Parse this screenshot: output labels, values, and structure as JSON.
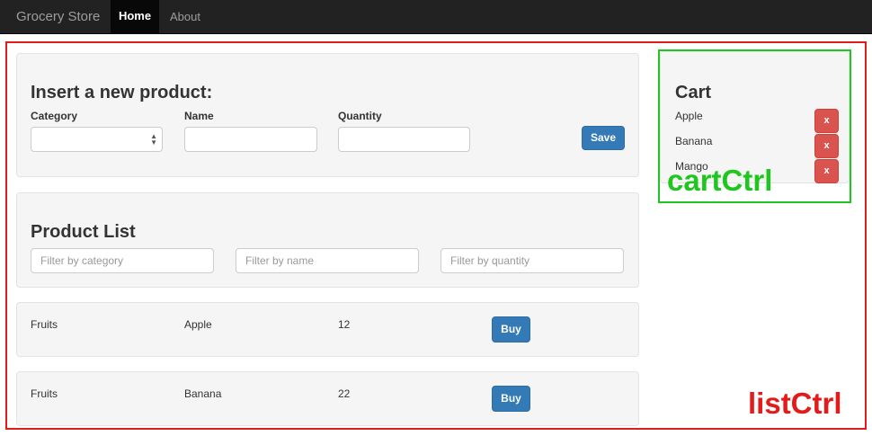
{
  "navbar": {
    "brand": "Grocery Store",
    "home": "Home",
    "about": "About"
  },
  "insert": {
    "title": "Insert a new product:",
    "category_label": "Category",
    "name_label": "Name",
    "quantity_label": "Quantity",
    "category_value": "",
    "name_value": "",
    "quantity_value": "",
    "save_label": "Save"
  },
  "product_list": {
    "title": "Product List",
    "filters": {
      "category_placeholder": "Filter by category",
      "name_placeholder": "Filter by name",
      "quantity_placeholder": "Filter by quantity"
    },
    "rows": [
      {
        "category": "Fruits",
        "name": "Apple",
        "quantity": "12",
        "buy_label": "Buy"
      },
      {
        "category": "Fruits",
        "name": "Banana",
        "quantity": "22",
        "buy_label": "Buy"
      }
    ]
  },
  "cart": {
    "title": "Cart",
    "items": [
      {
        "name": "Apple",
        "remove_label": "x"
      },
      {
        "name": "Banana",
        "remove_label": "x"
      },
      {
        "name": "Mango",
        "remove_label": "x"
      }
    ]
  },
  "annotations": {
    "list_ctrl": "listCtrl",
    "cart_ctrl": "cartCtrl"
  },
  "colors": {
    "navbar": "#222222",
    "primary": "#337ab7",
    "danger": "#d9534f",
    "annotation_red": "#e41b1b",
    "annotation_green": "#1fc61f"
  }
}
